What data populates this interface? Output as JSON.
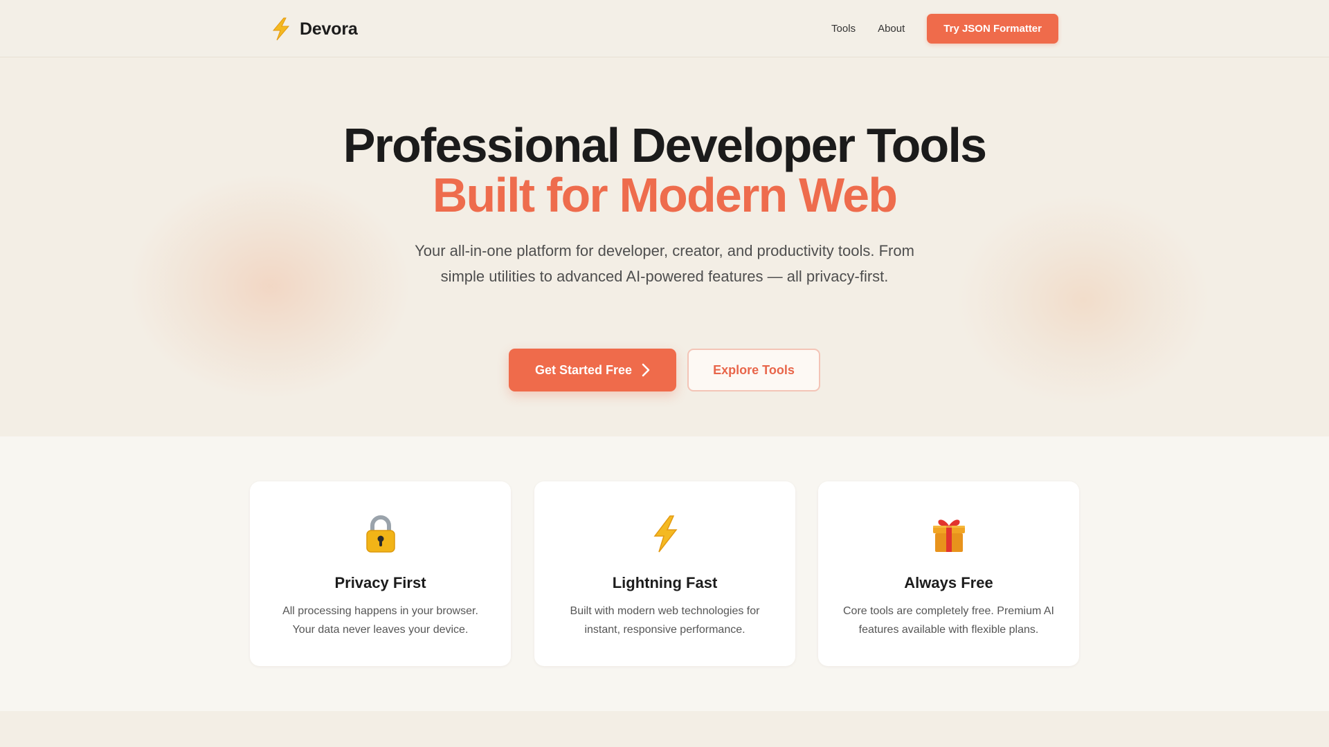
{
  "header": {
    "brand_icon": "lightning-icon",
    "brand_name": "Devora",
    "nav": [
      {
        "label": "Tools"
      },
      {
        "label": "About"
      }
    ],
    "cta_label": "Try JSON Formatter"
  },
  "hero": {
    "title_line1": "Professional Developer Tools",
    "title_line2": "Built for Modern Web",
    "subtitle": "Your all-in-one platform for developer, creator, and productivity tools. From simple utilities to advanced AI-powered features — all privacy-first.",
    "primary_button": "Get Started Free",
    "primary_icon": "chevron-right-icon",
    "secondary_button": "Explore Tools"
  },
  "features": [
    {
      "icon": "lock-icon",
      "title": "Privacy First",
      "description": "All processing happens in your browser. Your data never leaves your device."
    },
    {
      "icon": "lightning-icon",
      "title": "Lightning Fast",
      "description": "Built with modern web technologies for instant, responsive performance."
    },
    {
      "icon": "gift-icon",
      "title": "Always Free",
      "description": "Core tools are completely free. Premium AI features available with flexible plans."
    }
  ],
  "colors": {
    "accent": "#ef6b4b",
    "background": "#f3eee5",
    "card": "#ffffff",
    "text": "#1b1b1b"
  }
}
